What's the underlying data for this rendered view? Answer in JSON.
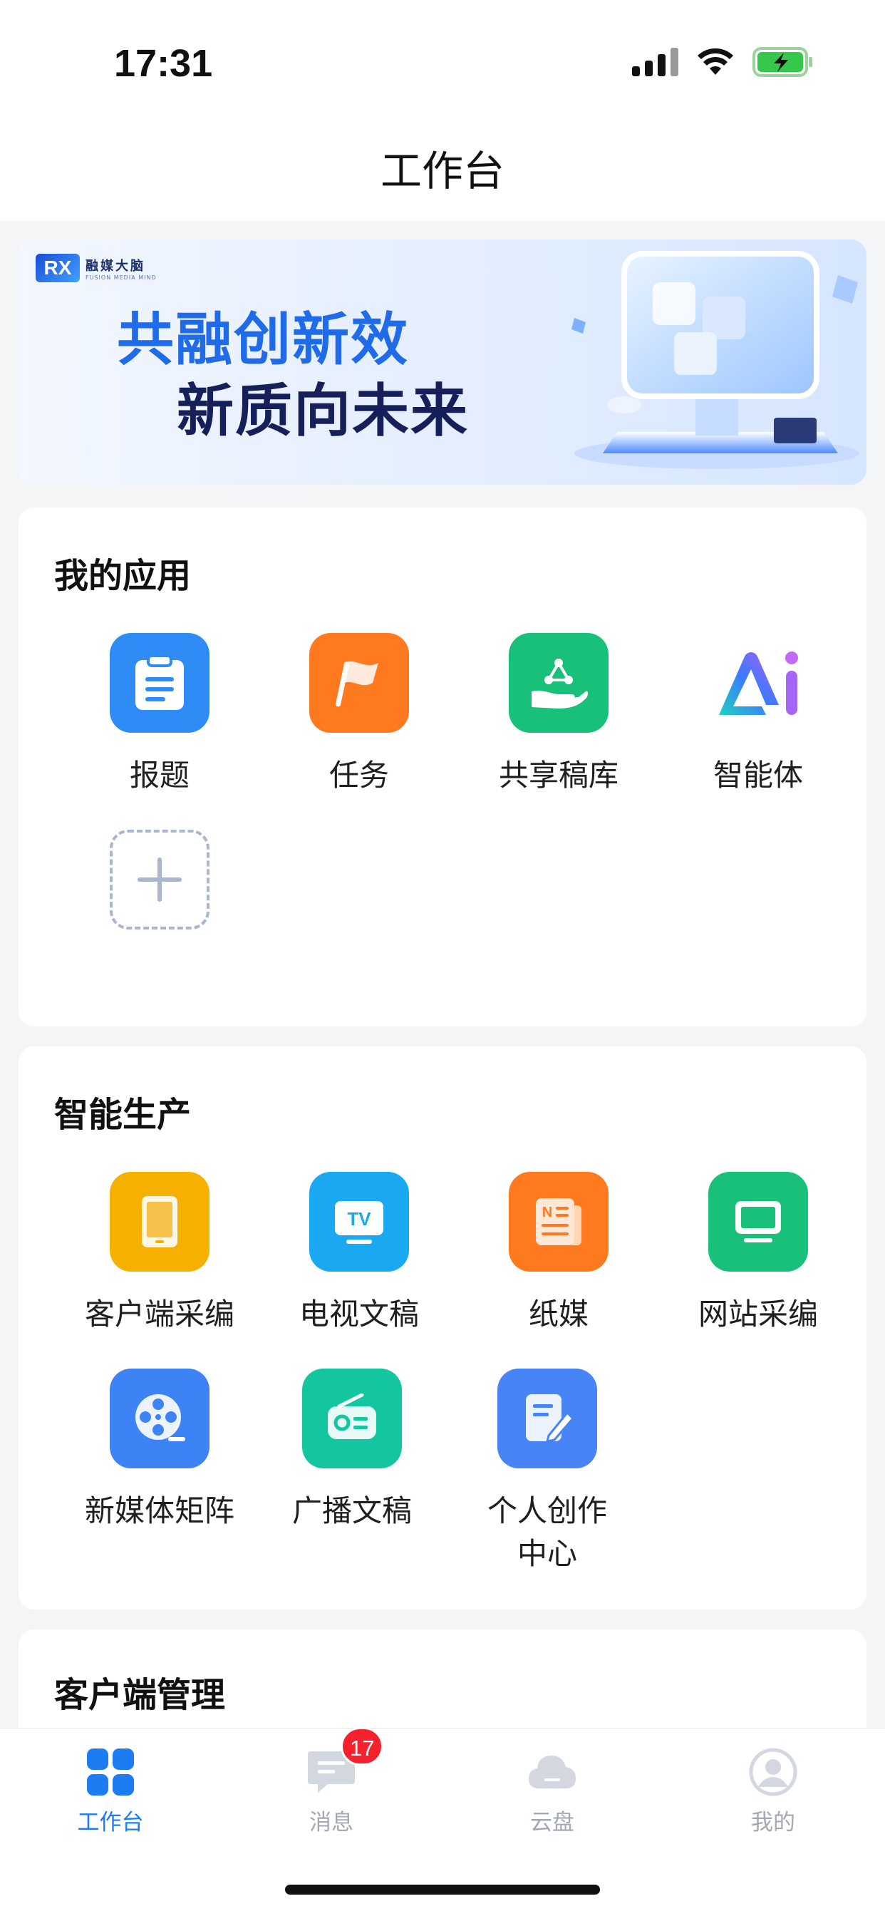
{
  "status_bar": {
    "time": "17:31"
  },
  "page_title": "工作台",
  "banner": {
    "logo_mark": "RX",
    "logo_cn": "融媒大脑",
    "logo_en": "FUSION MEDIA MIND",
    "line1": "共融创新效",
    "line2": "新质向未来"
  },
  "my_apps": {
    "title": "我的应用",
    "items": [
      {
        "label": "报题",
        "icon": "clipboard-icon",
        "color": "#2f8cf6"
      },
      {
        "label": "任务",
        "icon": "flag-icon",
        "color": "#ff7a1f"
      },
      {
        "label": "共享稿库",
        "icon": "shared-hand-icon",
        "color": "#19c07a"
      },
      {
        "label": "智能体",
        "icon": "ai-logo-icon",
        "color": "#7b5cf6"
      }
    ]
  },
  "smart_production": {
    "title": "智能生产",
    "items": [
      {
        "label": "客户端采编",
        "icon": "tablet-icon",
        "color": "#f5b000"
      },
      {
        "label": "电视文稿",
        "icon": "tv-icon",
        "color": "#1aa9f0"
      },
      {
        "label": "纸媒",
        "icon": "newspaper-icon",
        "color": "#ff7a1f"
      },
      {
        "label": "网站采编",
        "icon": "monitor-icon",
        "color": "#19c07a"
      },
      {
        "label": "新媒体矩阵",
        "icon": "film-reel-icon",
        "color": "#3d83f5"
      },
      {
        "label": "广播文稿",
        "icon": "radio-icon",
        "color": "#14c6a0"
      },
      {
        "label": "个人创作中心",
        "icon": "edit-document-icon",
        "color": "#4784f6"
      }
    ]
  },
  "client_management": {
    "title": "客户端管理"
  },
  "tab_bar": {
    "items": [
      {
        "label": "工作台",
        "icon": "grid-icon",
        "active": true
      },
      {
        "label": "消息",
        "icon": "message-icon",
        "badge": "17"
      },
      {
        "label": "云盘",
        "icon": "cloud-icon"
      },
      {
        "label": "我的",
        "icon": "profile-icon"
      }
    ]
  },
  "colors": {
    "accent": "#1d7cf2",
    "badge": "#f5222d",
    "background": "#f4f5f7"
  }
}
